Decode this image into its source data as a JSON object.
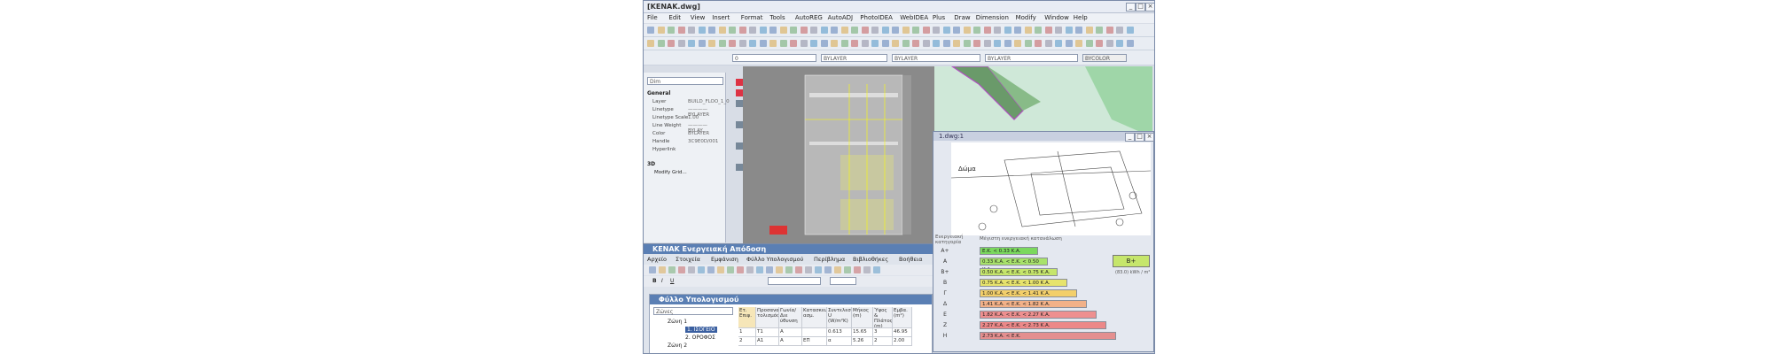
{
  "window": {
    "title": "[KENAK.dwg]"
  },
  "menu": [
    "File",
    "Edit",
    "View",
    "Insert",
    "Format",
    "Tools",
    "AutoREG",
    "AutoADJ",
    "PhotoIDEA",
    "WebIDEA",
    "Plus",
    "Draw",
    "Dimension",
    "Modify",
    "Window",
    "Help"
  ],
  "toolbar": {
    "layer_value": "0",
    "bylayer_1": "BYLAYER",
    "bylayer_2": "BYLAYER",
    "bylayer_3": "BYLAYER",
    "bycolor": "BYCOLOR"
  },
  "properties": {
    "selector": "Dim",
    "group_general": "General",
    "group_3d": "3D",
    "rows": [
      {
        "label": "Layer",
        "value": "BUILD_FLOO_1_0"
      },
      {
        "label": "Linetype",
        "value": "———— BYLAYER"
      },
      {
        "label": "Linetype Scale",
        "value": "1.00"
      },
      {
        "label": "Line Weight",
        "value": "———— BYLAY"
      },
      {
        "label": "Color",
        "value": "BYLAYER"
      },
      {
        "label": "Handle",
        "value": "3C9E0D/001"
      },
      {
        "label": "Hyperlink",
        "value": ""
      }
    ],
    "modify_label": "Modify Grid..."
  },
  "subwindow": {
    "title": "1.dwg:1",
    "plan_label": "Δώμα"
  },
  "energy": {
    "left_header": "Ενεργειακή κατηγορία",
    "right_header": "Μέγιστη ενεργειακή κατανάλωση",
    "result": "B+",
    "unit": "(83.0) kWh / m²",
    "colors": [
      "#7bd85e",
      "#a8e26a",
      "#c6e66c",
      "#e7e36c",
      "#f3cf6a",
      "#f2b188",
      "#ee8f8f",
      "#ec8888",
      "#e48f8f",
      "#dc8a8a"
    ],
    "rows": [
      {
        "cls": "A+",
        "text": "Ε.Κ. < 0.33 Κ.Α."
      },
      {
        "cls": "A",
        "text": "0.33 Κ.Α. < Ε.Κ. < 0.50 Κ.Α."
      },
      {
        "cls": "B+",
        "text": "0.50 Κ.Α. < Ε.Κ. < 0.75 Κ.Α."
      },
      {
        "cls": "B",
        "text": "0.75 Κ.Α. < Ε.Κ. < 1.00 Κ.Α."
      },
      {
        "cls": "Γ",
        "text": "1.00 Κ.Α. < Ε.Κ. < 1.41 Κ.Α."
      },
      {
        "cls": "Δ",
        "text": "1.41 Κ.Α. < Ε.Κ. < 1.82 Κ.Α."
      },
      {
        "cls": "Ε",
        "text": "1.82 Κ.Α. < Ε.Κ. < 2.27 Κ.Α."
      },
      {
        "cls": "Ζ",
        "text": "2.27 Κ.Α. < Ε.Κ. < 2.73 Κ.Α."
      },
      {
        "cls": "Η",
        "text": "2.73 Κ.Α. < Ε.Κ."
      }
    ]
  },
  "kenak": {
    "title": "KENAK Ενεργειακή Απόδοση",
    "menu": [
      "Αρχείο",
      "Στοιχεία",
      "Εμφάνιση",
      "Φύλλο Υπολογισμού",
      "Περίβλημα",
      "Βιβλιοθήκες",
      "Βοήθεια"
    ],
    "sheet_title": "Φύλλο Υπολογισμού",
    "zones_label": "Ζώνες",
    "tree": [
      {
        "label": "Ζώνη 1"
      },
      {
        "label": "1. ΙΣΟΓΕΙΟ"
      },
      {
        "label": "2. ΟΡΟΦΟΣ"
      },
      {
        "label": "Ζώνη 2"
      }
    ],
    "columns": [
      "Ετ. Επιφ.",
      "Προσανα τολισμός",
      "Γωνία/Διε ύθυνση",
      "Κατασκευ ασμ.",
      "Συντελεστ. U (W/m²K)",
      "Μήκος (m)",
      "Ύψος & Πλάτος (m)",
      "Εμβα. (m²)"
    ],
    "rows": [
      [
        "1",
        "T1",
        "A",
        "",
        "0.613",
        "15.65",
        "3",
        "46.95"
      ],
      [
        "2",
        "A1",
        "A",
        "ΕΠ",
        "α",
        "5.26",
        "2",
        "2.00"
      ]
    ]
  }
}
